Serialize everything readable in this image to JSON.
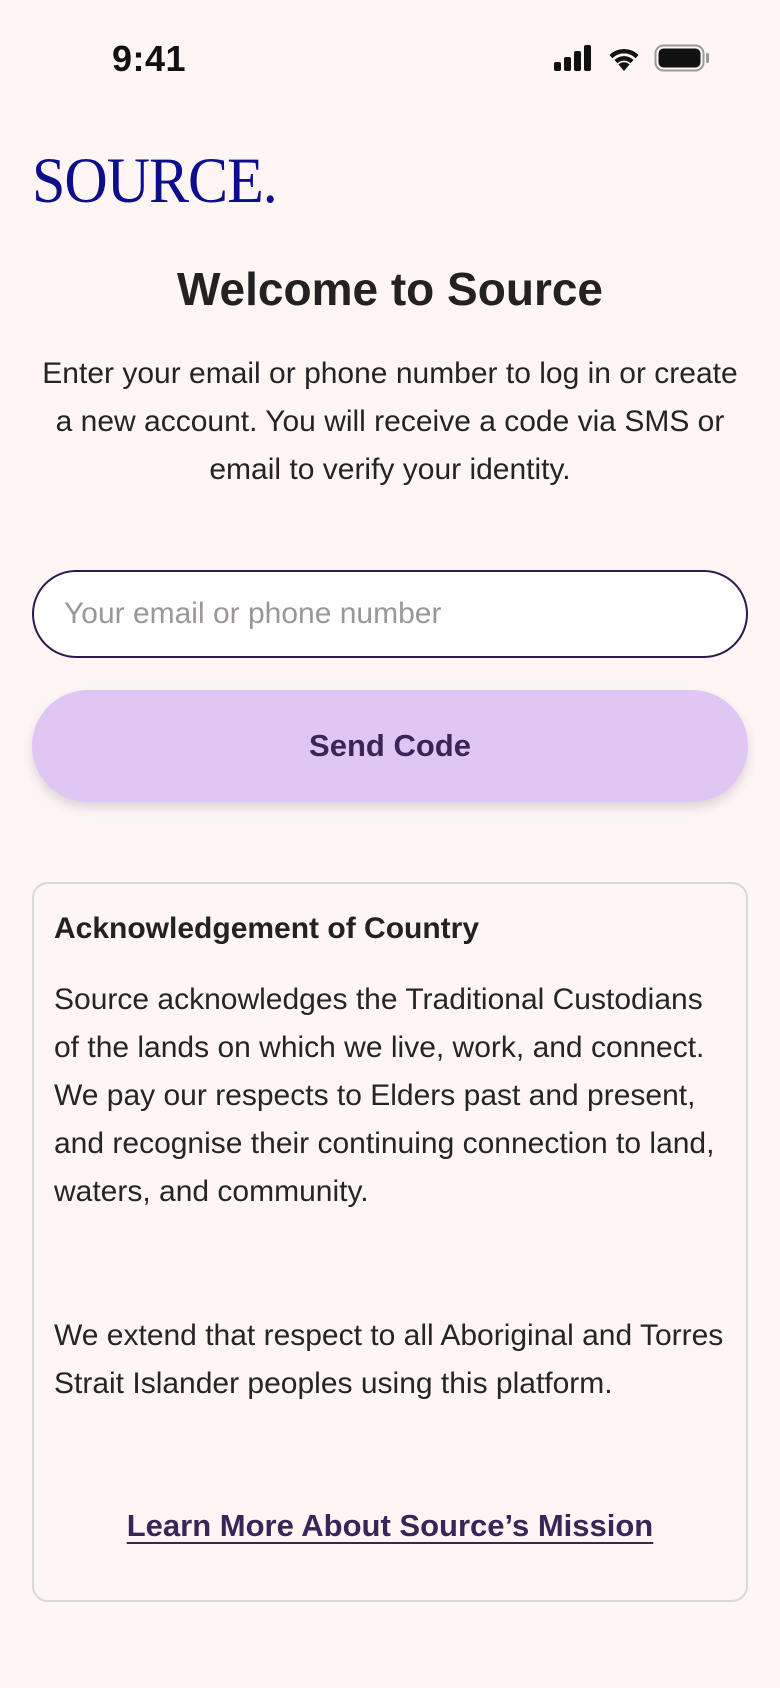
{
  "status_bar": {
    "time": "9:41",
    "icons": [
      "cellular-signal-icon",
      "wifi-icon",
      "battery-icon"
    ]
  },
  "brand": {
    "logo_text": "SOURCE.",
    "logo_color": "#0e0d8c"
  },
  "login": {
    "title": "Welcome to Source",
    "subtitle": "Enter your email or phone number to log in or create a new account. You will receive a code via SMS or email to verify your identity.",
    "input_value": "",
    "input_placeholder": "Your email or phone number",
    "send_button_label": "Send Code"
  },
  "acknowledgement": {
    "heading": "Acknowledgement of Country",
    "paragraph_1": "Source acknowledges the Traditional Custodians of the lands on which we live, work, and connect. We pay our respects to Elders past and present, and recognise their continuing connection to land, waters, and community.",
    "paragraph_2": "We extend that respect to all Aboriginal and Torres Strait Islander peoples using this platform.",
    "link_label": "Learn More About Source’s Mission"
  },
  "colors": {
    "background": "#fdf6f4",
    "button_fill": "#dfc6f3",
    "button_text": "#3b2457",
    "input_border": "#2c1a4d"
  }
}
